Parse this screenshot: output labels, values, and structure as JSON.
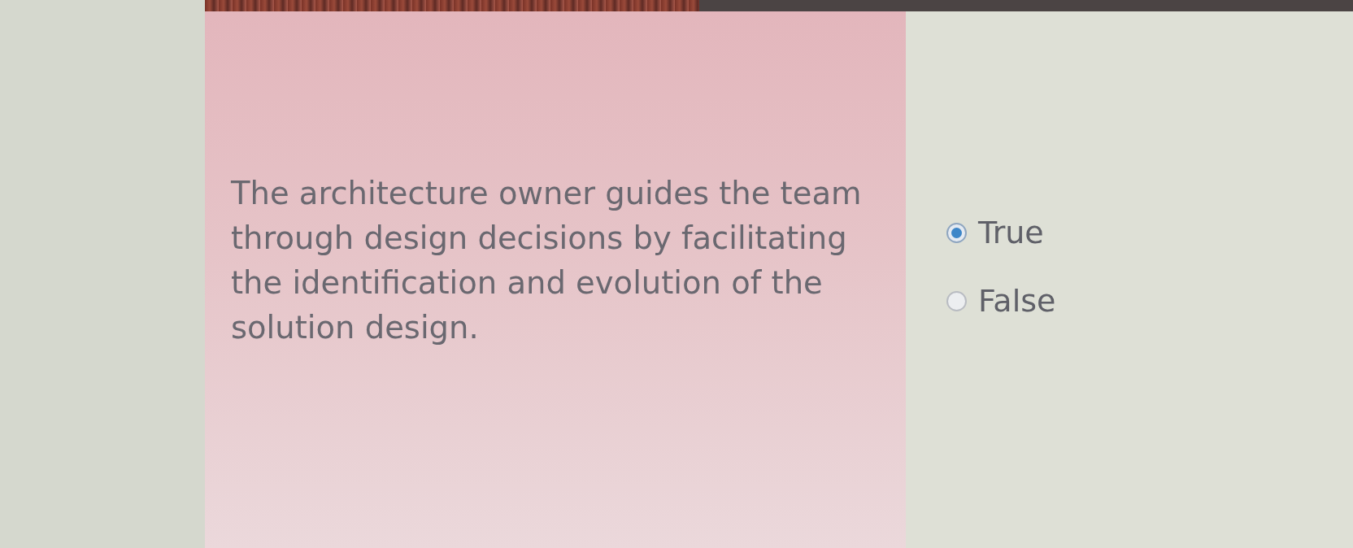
{
  "question": {
    "text": "The architecture owner guides the team through design decisions by facilitating the identification and evolution of the solution design."
  },
  "options": [
    {
      "label": "True",
      "selected": true
    },
    {
      "label": "False",
      "selected": false
    }
  ]
}
